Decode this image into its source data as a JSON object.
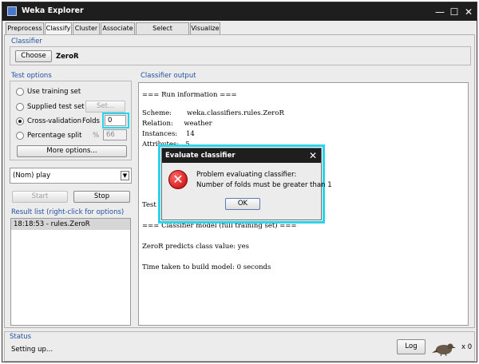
{
  "window": {
    "title": "Weka Explorer"
  },
  "tabs": [
    "Preprocess",
    "Classify",
    "Cluster",
    "Associate",
    "Select attributes",
    "Visualize"
  ],
  "classifier": {
    "section": "Classifier",
    "choose_label": "Choose",
    "name": "ZeroR"
  },
  "test_options": {
    "section": "Test options",
    "use_training": "Use training set",
    "supplied_test": "Supplied test set",
    "set_label": "Set...",
    "cross_validation": "Cross-validation",
    "folds_label": "Folds",
    "folds_value": "0",
    "percentage_split": "Percentage split",
    "percent_sign": "%",
    "percent_value": "66",
    "more_options": "More options..."
  },
  "class_select": {
    "value": "(Nom) play"
  },
  "actions": {
    "start": "Start",
    "stop": "Stop"
  },
  "result_list": {
    "section": "Result list (right-click for options)",
    "items": [
      "18:18:53 - rules.ZeroR"
    ]
  },
  "output": {
    "section": "Classifier output",
    "lines": [
      "=== Run information ===",
      "",
      "Scheme:       weka.classifiers.rules.ZeroR",
      "Relation:     weather",
      "Instances:    14",
      "Attributes:   5",
      "Test",
      "=== Classifier model (full training set) ===",
      "ZeroR predicts class value: yes",
      "Time taken to build model: 0 seconds"
    ]
  },
  "status": {
    "section": "Status",
    "text": "Setting up...",
    "log_label": "Log",
    "count": "x 0"
  },
  "dialog": {
    "title": "Evaluate classifier",
    "line1": "Problem evaluating classifier:",
    "line2": "Number of folds must be greater than 1",
    "ok_label": "OK"
  },
  "colors": {
    "highlight": "#29d3e9",
    "section_title": "#2450a0",
    "titlebar": "#1e1e1e"
  }
}
